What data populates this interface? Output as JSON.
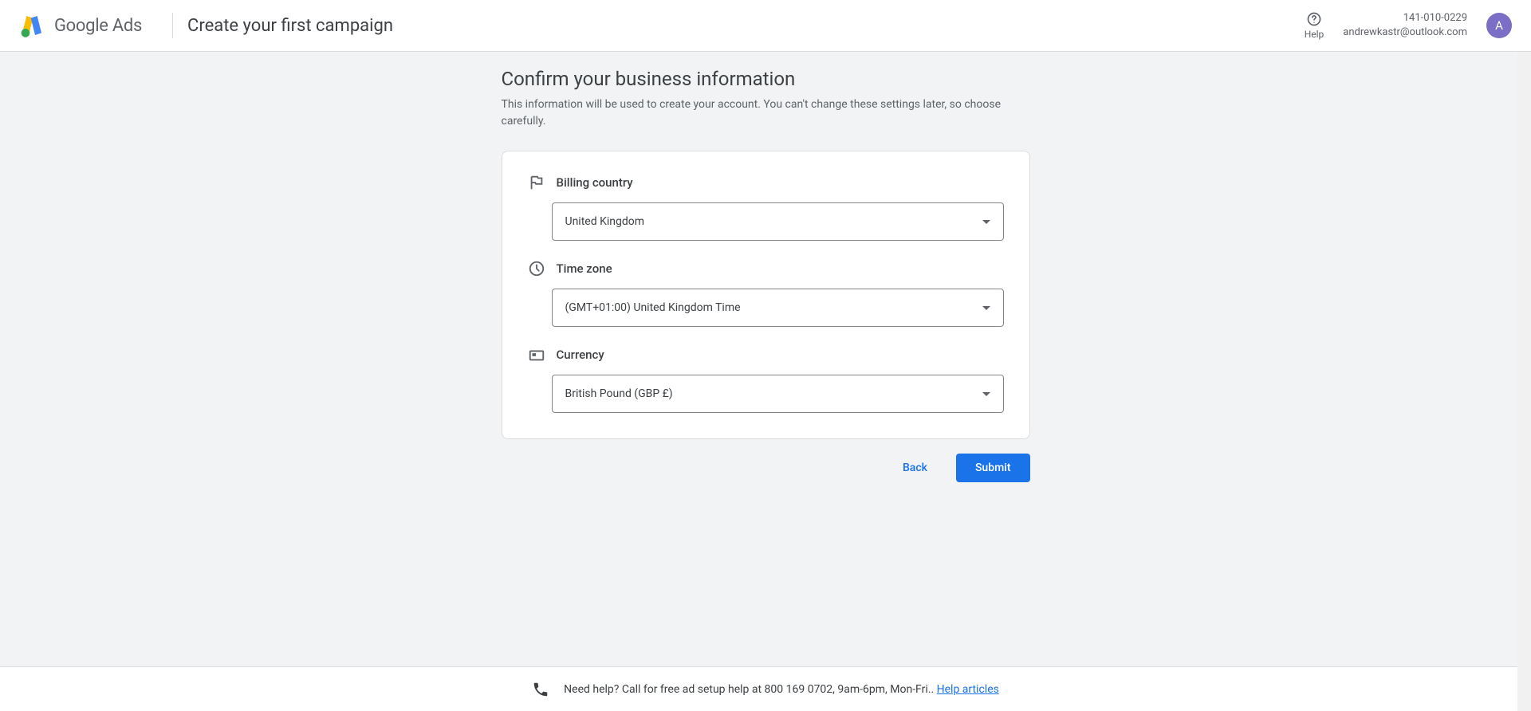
{
  "header": {
    "logo_text_google": "Google",
    "logo_text_ads": " Ads",
    "page_title": "Create your first campaign",
    "help_label": "Help",
    "account_id": "141-010-0229",
    "account_email": "andrewkastr@outlook.com",
    "avatar_initial": "A"
  },
  "main": {
    "heading": "Confirm your business information",
    "subtext": "This information will be used to create your account. You can't change these settings later, so choose carefully.",
    "fields": {
      "billing_country": {
        "label": "Billing country",
        "value": "United Kingdom"
      },
      "time_zone": {
        "label": "Time zone",
        "value": "(GMT+01:00) United Kingdom Time"
      },
      "currency": {
        "label": "Currency",
        "value": "British Pound (GBP £)"
      }
    },
    "actions": {
      "back": "Back",
      "submit": "Submit"
    }
  },
  "footer": {
    "text": "Need help? Call for free ad setup help at 800 169 0702, 9am-6pm, Mon-Fri.. ",
    "link": "Help articles"
  }
}
